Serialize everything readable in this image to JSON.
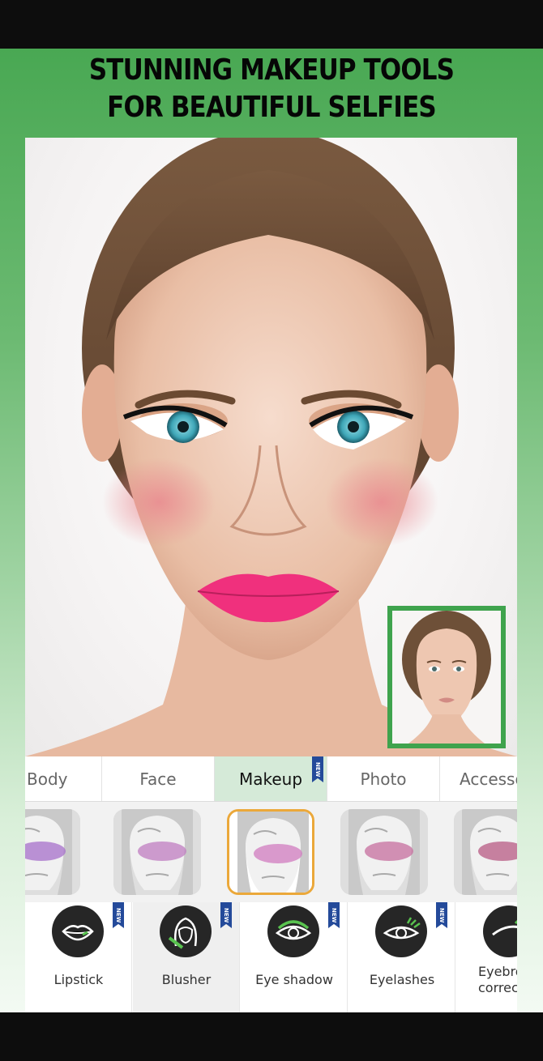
{
  "headline": {
    "line1": "STUNNING MAKEUP TOOLS",
    "line2": "FOR BEAUTIFUL SELFIES"
  },
  "tabs": [
    {
      "label": "Body",
      "active": false,
      "new": false
    },
    {
      "label": "Face",
      "active": false,
      "new": false
    },
    {
      "label": "Makeup",
      "active": true,
      "new": true
    },
    {
      "label": "Photo",
      "active": false,
      "new": false
    },
    {
      "label": "Accesso",
      "active": false,
      "new": false
    }
  ],
  "new_badge": "NEW",
  "blush_swatches": [
    "#a56fc9",
    "#bf7cc0",
    "#d07bbf",
    "#c66e9e",
    "#b75a83"
  ],
  "selected_swatch": 2,
  "tools": [
    {
      "label": "Lipstick",
      "icon": "lips-icon",
      "new": true
    },
    {
      "label": "Blusher",
      "icon": "blusher-face-icon",
      "new": true
    },
    {
      "label": "Eye shadow",
      "icon": "eye-shadow-icon",
      "new": true
    },
    {
      "label": "Eyelashes",
      "icon": "eyelashes-icon",
      "new": true
    },
    {
      "label": "Eyebro correc",
      "label_line1": "Eyebro",
      "label_line2": "correc",
      "icon": "eyebrow-icon",
      "new": false
    }
  ],
  "active_tool": "Blusher",
  "colors": {
    "accent_green": "#3fa34d",
    "selection_orange": "#eba83a",
    "lipstick_pink": "#f0307d",
    "new_badge_blue": "#244a9a"
  }
}
